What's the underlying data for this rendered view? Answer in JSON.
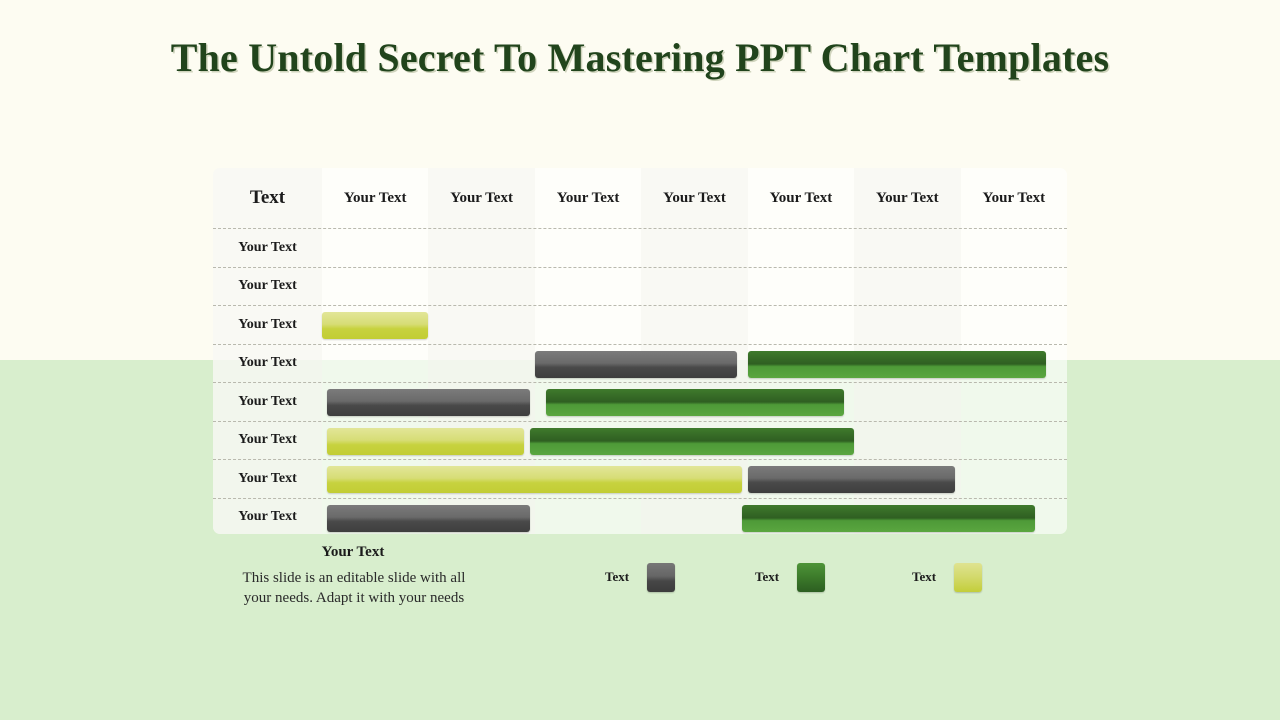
{
  "slide": {
    "title": "The Untold Secret To Mastering PPT Chart Templates",
    "background_top_color": "#fdfcf2",
    "background_bottom_color": "#d8eecd"
  },
  "caption": {
    "title": "Your Text",
    "body": "This slide is an editable slide with all your needs. Adapt it with your needs"
  },
  "legend": {
    "items": [
      {
        "label": "Text",
        "swatch": "gray-swatch",
        "color": "#4a4a4a"
      },
      {
        "label": "Text",
        "swatch": "green-swatch",
        "color": "#3c7a2a"
      },
      {
        "label": "Text",
        "swatch": "yellow-swatch",
        "color": "#c3ce3a"
      }
    ]
  },
  "chart_data": {
    "type": "bar",
    "title": "The Untold Secret To Mastering PPT Chart Templates",
    "orientation": "horizontal",
    "grid": "dashed-row-separators",
    "legend_position": "bottom-right",
    "xlabel": "",
    "ylabel": "",
    "columns": [
      "Text",
      "Your Text",
      "Your Text",
      "Your Text",
      "Your Text",
      "Your Text",
      "Your Text",
      "Your Text"
    ],
    "categories": [
      "Your Text",
      "Your Text",
      "Your Text",
      "Your Text",
      "Your Text",
      "Your Text",
      "Your Text",
      "Your Text"
    ],
    "series": [
      {
        "name": "Text",
        "key": "gray",
        "color": "#4a4a4a"
      },
      {
        "name": "Text",
        "key": "green",
        "color": "#3c7a2a"
      },
      {
        "name": "Text",
        "key": "yellow",
        "color": "#c3ce3a"
      }
    ],
    "bars": [
      [],
      [],
      [
        {
          "series": "yellow",
          "start": 1.0,
          "end": 2.0
        }
      ],
      [
        {
          "series": "gray",
          "start": 3.0,
          "end": 4.9
        },
        {
          "series": "green",
          "start": 5.0,
          "end": 7.8
        }
      ],
      [
        {
          "series": "gray",
          "start": 1.05,
          "end": 2.95
        },
        {
          "series": "green",
          "start": 3.1,
          "end": 5.9
        }
      ],
      [
        {
          "series": "yellow",
          "start": 1.05,
          "end": 2.9
        },
        {
          "series": "green",
          "start": 2.95,
          "end": 6.0
        }
      ],
      [
        {
          "series": "yellow",
          "start": 1.05,
          "end": 4.95
        },
        {
          "series": "gray",
          "start": 5.0,
          "end": 6.95
        }
      ],
      [
        {
          "series": "gray",
          "start": 1.05,
          "end": 2.95
        },
        {
          "series": "green",
          "start": 4.95,
          "end": 7.7
        }
      ]
    ]
  }
}
